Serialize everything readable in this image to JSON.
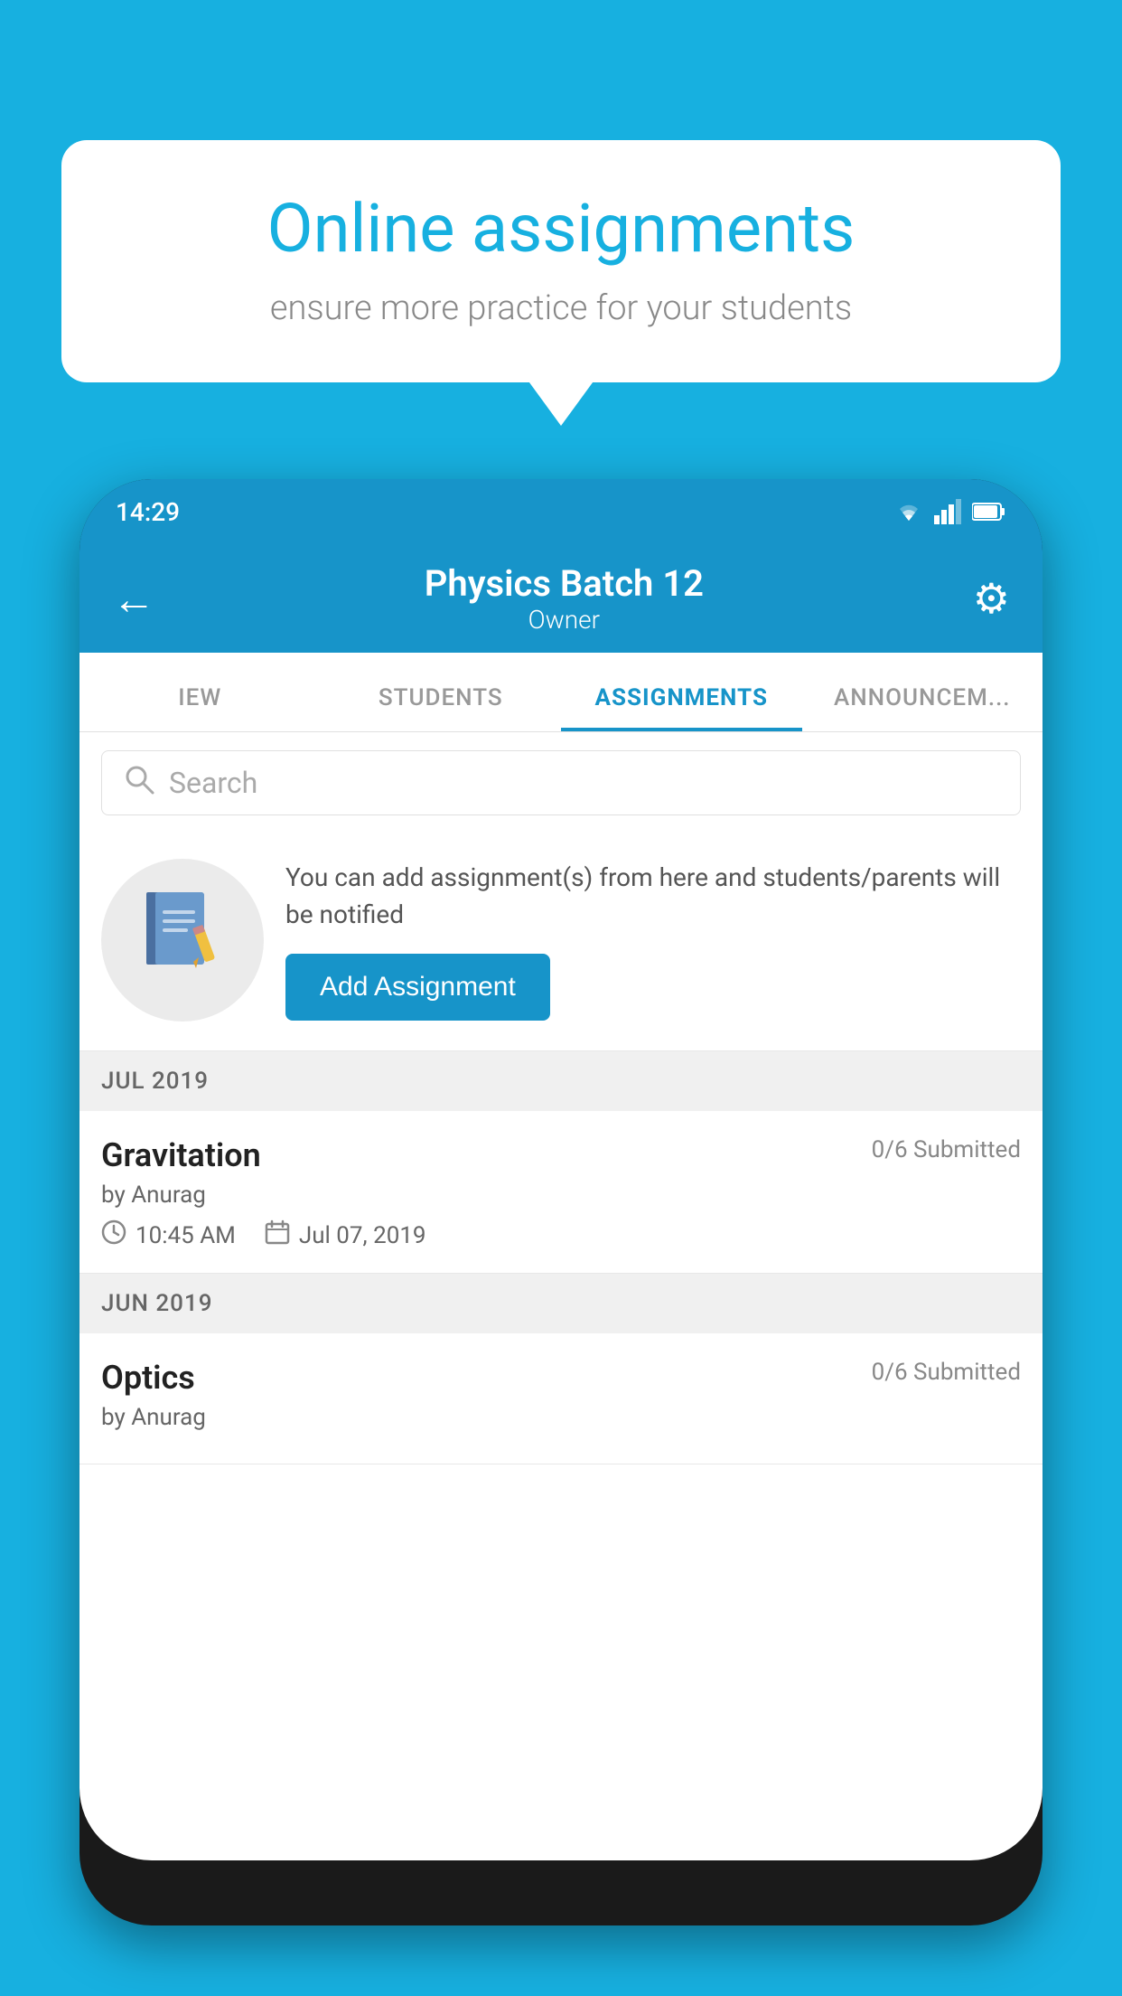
{
  "background": {
    "color": "#17b0e0"
  },
  "speech_bubble": {
    "heading": "Online assignments",
    "subtext": "ensure more practice for your students"
  },
  "phone": {
    "status_bar": {
      "time": "14:29"
    },
    "header": {
      "batch_name": "Physics Batch 12",
      "role": "Owner",
      "back_label": "←",
      "settings_label": "⚙"
    },
    "tabs": [
      {
        "label": "IEW",
        "active": false
      },
      {
        "label": "STUDENTS",
        "active": false
      },
      {
        "label": "ASSIGNMENTS",
        "active": true
      },
      {
        "label": "ANNOUNCEM...",
        "active": false
      }
    ],
    "search": {
      "placeholder": "Search"
    },
    "promo": {
      "description": "You can add assignment(s) from here and students/parents will be notified",
      "button_label": "Add Assignment"
    },
    "sections": [
      {
        "label": "JUL 2019",
        "assignments": [
          {
            "title": "Gravitation",
            "submitted": "0/6 Submitted",
            "by": "by Anurag",
            "time": "10:45 AM",
            "date": "Jul 07, 2019"
          }
        ]
      },
      {
        "label": "JUN 2019",
        "assignments": [
          {
            "title": "Optics",
            "submitted": "0/6 Submitted",
            "by": "by Anurag",
            "time": "",
            "date": ""
          }
        ]
      }
    ]
  }
}
